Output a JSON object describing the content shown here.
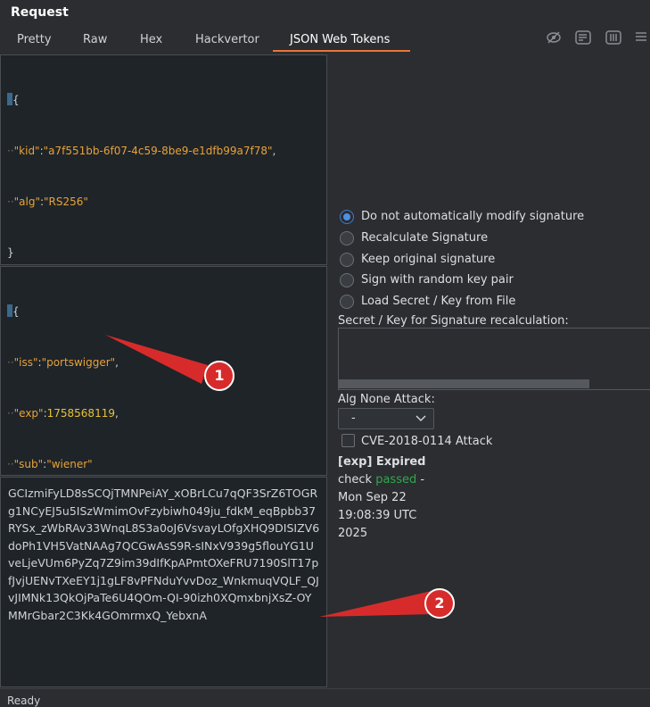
{
  "window": {
    "title": "Request"
  },
  "tabs": [
    {
      "label": "Pretty"
    },
    {
      "label": "Raw"
    },
    {
      "label": "Hex"
    },
    {
      "label": "Hackvertor"
    },
    {
      "label": "JSON Web Tokens"
    }
  ],
  "header_json": {
    "open": "{",
    "close": "}",
    "lines": [
      {
        "key": "\"kid\"",
        "value": "\"a7f551bb-6f07-4c59-8be9-e1dfb99a7f78\"",
        "sep": ":",
        "trail": ","
      },
      {
        "key": "\"alg\"",
        "value": "\"RS256\"",
        "sep": ":",
        "trail": ""
      }
    ]
  },
  "payload_json": {
    "open": "{",
    "close": "}",
    "lines": [
      {
        "key": "\"iss\"",
        "value": "\"portswigger\"",
        "sep": ":",
        "trail": ","
      },
      {
        "key": "\"exp\"",
        "value": "1758568119",
        "sep": ":",
        "trail": ","
      },
      {
        "key": "\"sub\"",
        "value": "\"wiener\"",
        "sep": ":",
        "trail": ""
      }
    ]
  },
  "signature": {
    "text": "GCIzmiFyLD8sSCQjTMNPeiAY_xOBrLCu7qQF3SrZ6TOGRg1NCyEJ5u5ISzWmimOvFzybiwh049ju_fdkM_eqBpbb37RYSx_zWbRAv33WnqL8S3a0oJ6VsvayLOfgXHQ9DISIZV6doPh1VH5VatNAAg7QCGwAsS9R-sINxV939g5flouYG1UveLjeVUm6PyZq7Z9im39dIfKpAPmtOXeFRU7190SlT17pfJvjUENvTXeEY1j1gLF8vPFNduYvvDoz_WnkmuqVQLF_QJvJIMNk13QkOjPaTe6U4QOm-QI-90izh0XQmxbnjXsZ-OYMMrGbar2C3Kk4GOmrmxQ_YebxnA"
  },
  "options": {
    "radios": [
      {
        "label": "Do not automatically modify signature",
        "checked": true
      },
      {
        "label": "Recalculate Signature",
        "checked": false
      },
      {
        "label": "Keep original signature",
        "checked": false
      },
      {
        "label": "Sign with random key pair",
        "checked": false
      },
      {
        "label": "Load Secret / Key from File",
        "checked": false
      }
    ],
    "secret_label": "Secret / Key for Signature recalculation:",
    "secret_value": "",
    "alg_none_label": "Alg None Attack:",
    "alg_none_value": "-",
    "cve_label": "CVE-2018-0114 Attack",
    "cve_checked": false
  },
  "status": {
    "expired": "[exp] Expired",
    "check_prefix": "check ",
    "passed": "passed",
    "check_suffix": " -",
    "date": "Mon Sep 22 19:08:39 UTC 2025"
  },
  "annotations": [
    {
      "label": "1"
    },
    {
      "label": "2"
    }
  ],
  "bottom": {
    "text": "Ready"
  },
  "colors": {
    "accent": "#e8753a",
    "json_string": "#e8a23a",
    "passed": "#2fa84f",
    "badge": "#d72b2b"
  }
}
